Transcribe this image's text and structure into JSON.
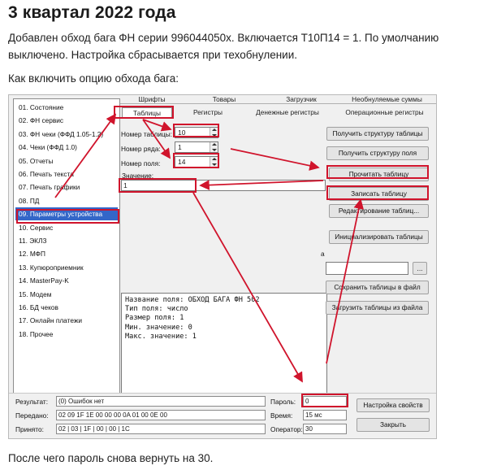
{
  "article": {
    "heading": "3 квартал 2022 года",
    "p1": "Добавлен обход бага ФН серии 996044050х. Включается Т10П14 = 1. По умолчанию выключено. Настройка сбрасывается при техобнулении.",
    "p2": "Как включить опцию обхода бага:",
    "p3": "После чего пароль снова вернуть на 30."
  },
  "sidebar": {
    "items": [
      "01. Состояние",
      "02. ФН сервис",
      "03. ФН чеки (ФФД 1.05-1.2)",
      "04. Чеки (ФФД 1.0)",
      "05. Отчеты",
      "06. Печать текста",
      "07. Печать графики",
      "08. ПД",
      "09. Параметры устройства",
      "10. Сервис",
      "11. ЭКЛЗ",
      "12. МФП",
      "13. Купюроприемник",
      "14. MasterPay-K",
      "15. Модем",
      "16. БД чеков",
      "17. Онлайн платежи",
      "18. Прочее"
    ],
    "selected_index": 8
  },
  "tabs": {
    "top": [
      "Шрифты",
      "Товары",
      "Загрузчик",
      "Необнуляемые суммы"
    ],
    "bottom": [
      "Таблицы",
      "Регистры",
      "Денежные регистры",
      "Операционные регистры"
    ],
    "active": "Таблицы"
  },
  "form": {
    "table_label": "Номер таблицы:",
    "table_value": "10",
    "row_label": "Номер ряда:",
    "row_value": "1",
    "field_label": "Номер поля:",
    "field_value": "14",
    "value_label": "Значение:",
    "value_value": "1"
  },
  "memo_lines": [
    "Название поля: ОБХОД БАГА ФН 502",
    "Тип поля: число",
    "Размер поля: 1",
    "Мин. значение: 0",
    "Макс. значение: 1"
  ],
  "buttons": {
    "get_structure": "Получить структуру таблицы",
    "get_field_structure": "Получить структуру поля",
    "read_table": "Прочитать таблицу",
    "write_table": "Записать таблицу",
    "edit_table": "Редактирование таблиц...",
    "init_tables": "Инициализировать таблицы",
    "file_browse": "...",
    "save_file": "Сохранить таблицы в файл",
    "load_file": "Загрузить таблицы из файла",
    "settings": "Настройка свойств",
    "close": "Закрыть"
  },
  "file_label": "а",
  "status": {
    "result_label": "Результат:",
    "result_value": "(0) Ошибок нет",
    "sent_label": "Передано:",
    "sent_value": "02 09 1F 1E 00 00 00 0A 01 00 0E 00",
    "recv_label": "Принято:",
    "recv_value": "02 | 03 | 1F | 00 | 00 | 1C",
    "password_label": "Пароль:",
    "password_value": "0",
    "time_label": "Время:",
    "time_value": "15 мс",
    "operator_label": "Оператор:",
    "operator_value": "30"
  },
  "colors": {
    "highlight_red": "#d0142c",
    "selection_blue": "#3366c8"
  }
}
